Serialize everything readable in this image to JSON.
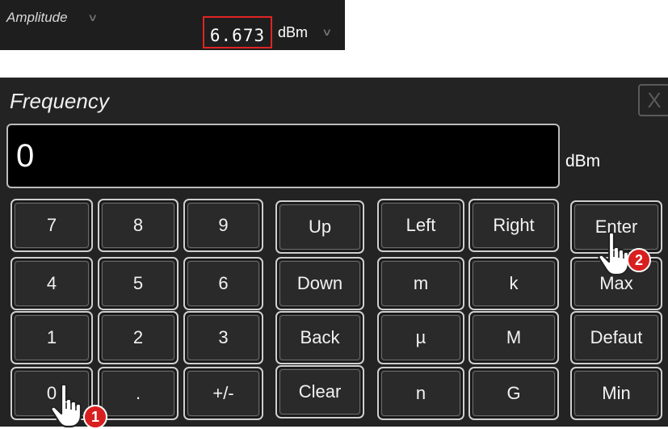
{
  "amplitude_bar": {
    "label": "Amplitude",
    "value": "6.673",
    "unit": "dBm",
    "highlight_color": "#e02424"
  },
  "dialog": {
    "title": "Frequency",
    "close_label": "X",
    "entry_value": "0",
    "entry_unit": "dBm"
  },
  "keys": {
    "k7": "7",
    "k8": "8",
    "k9": "9",
    "k4": "4",
    "k5": "5",
    "k6": "6",
    "k1": "1",
    "k2": "2",
    "k3": "3",
    "k0": "0",
    "dot": ".",
    "sign": "+/-",
    "up": "Up",
    "down": "Down",
    "back": "Back",
    "clear": "Clear",
    "left": "Left",
    "right": "Right",
    "m_small": "m",
    "k_small": "k",
    "mu": "µ",
    "M_big": "M",
    "n": "n",
    "G": "G",
    "enter": "Enter",
    "max": "Max",
    "default": "Defaut",
    "min": "Min"
  },
  "annotations": {
    "step1": "1",
    "step2": "2",
    "badge_color": "#d81f1f"
  }
}
